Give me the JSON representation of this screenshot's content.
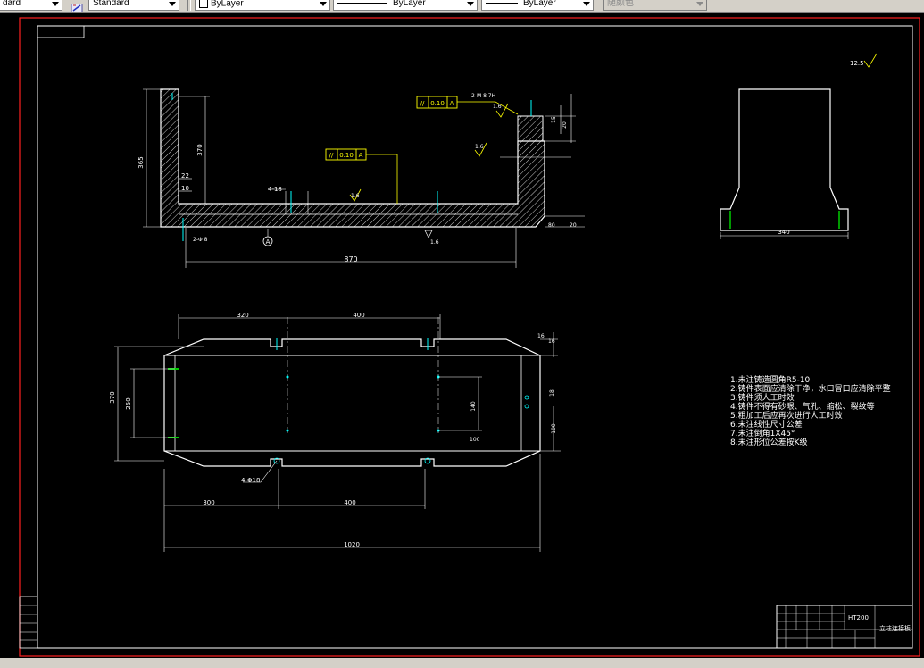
{
  "toolbar": {
    "text_style": "dard",
    "dim_style": "Standard",
    "layer_color": "ByLayer",
    "linetype": "ByLayer",
    "lineweight": "ByLayer",
    "plot_style": "随颜色"
  },
  "drawing": {
    "front_view": {
      "dim_height_total": "365",
      "dim_height_inner": "370",
      "dim_small_1": "22",
      "dim_small_2": "10",
      "dim_length": "870",
      "dim_hole": "4-18",
      "flatness_1_sym": "//",
      "flatness_1_val": "0.10",
      "flatness_1_ref": "A",
      "flatness_2_sym": "//",
      "flatness_2_val": "0.10",
      "flatness_2_ref": "A",
      "thread_note": "2-M 8 7H",
      "rough_1": "1.6",
      "rough_2": "1.6",
      "rough_3": "1.6",
      "rough_4": "1.6",
      "datum": "A",
      "dim_right_1": "20",
      "dim_right_2": "15",
      "dim_right_3": "80",
      "dim_right_4": "20"
    },
    "side_view": {
      "dim_width": "340",
      "rough_note": "12.5"
    },
    "top_view": {
      "dim_top_1": "320",
      "dim_top_2": "400",
      "dim_bottom_1": "300",
      "dim_bottom_2": "400",
      "dim_total": "1020",
      "dim_left_outer": "370",
      "dim_left_inner": "250",
      "dim_right_1": "140",
      "dim_right_2": "100",
      "dim_right_3": "16",
      "dim_right_4": "16",
      "dim_right_5": "18",
      "hole_label": "4-Φ18"
    },
    "tech_notes": [
      "1.未注铸造圆角R5-10",
      "2.铸件表面应清除干净，水口冒口应清除平整",
      "3.铸件须人工时效",
      "4.铸件不得有砂眼、气孔、缩松、裂纹等",
      "5.粗加工后应再次进行人工时效",
      "6.未注线性尺寸公差",
      "7.未注倒角1X45°",
      "8.未注形位公差按K级"
    ],
    "title_block": {
      "material": "HT200",
      "part_name": "立柱连接板"
    }
  },
  "colors": {
    "background": "#000000",
    "geometry": "#ffffff",
    "leader": "#ffff00",
    "center": "#00ffff",
    "marker": "#00cc00",
    "border": "#ff2020"
  }
}
